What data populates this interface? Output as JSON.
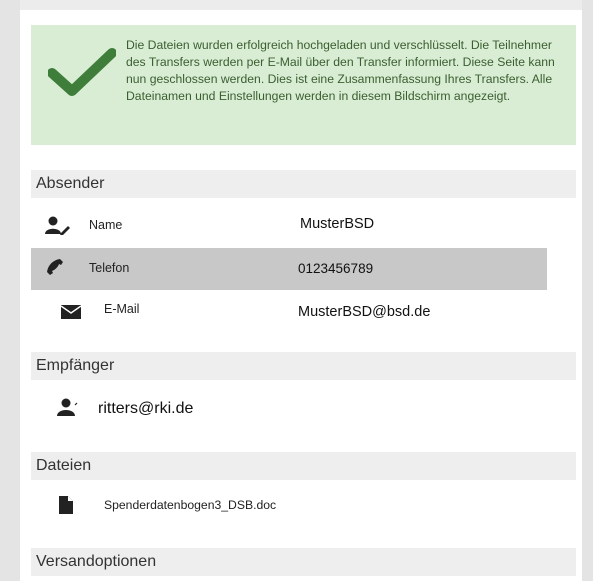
{
  "success": {
    "message": "Die Dateien wurden erfolgreich hochgeladen und verschlüsselt. Die Teilnehmer des Transfers werden per E-Mail über den Transfer informiert. Diese Seite kann nun geschlossen werden. Dies ist eine Zusammenfassung Ihres Transfers. Alle Dateinamen und Einstellungen werden in diesem Bildschirm angezeigt."
  },
  "sender": {
    "heading": "Absender",
    "name_label": "Name",
    "name_value": "MusterBSD",
    "phone_label": "Telefon",
    "phone_value": "0123456789",
    "email_label": "E-Mail",
    "email_value": "MusterBSD@bsd.de"
  },
  "recipients": {
    "heading": "Empfänger",
    "email": "ritters@rki.de"
  },
  "files": {
    "heading": "Dateien",
    "filename": "Spenderdatenbogen3_DSB.doc"
  },
  "options": {
    "heading": "Versandoptionen"
  },
  "colors": {
    "success_bg": "#d9edd4",
    "check_color": "#3f7d3a",
    "highlight_row": "#c8c8c8"
  }
}
